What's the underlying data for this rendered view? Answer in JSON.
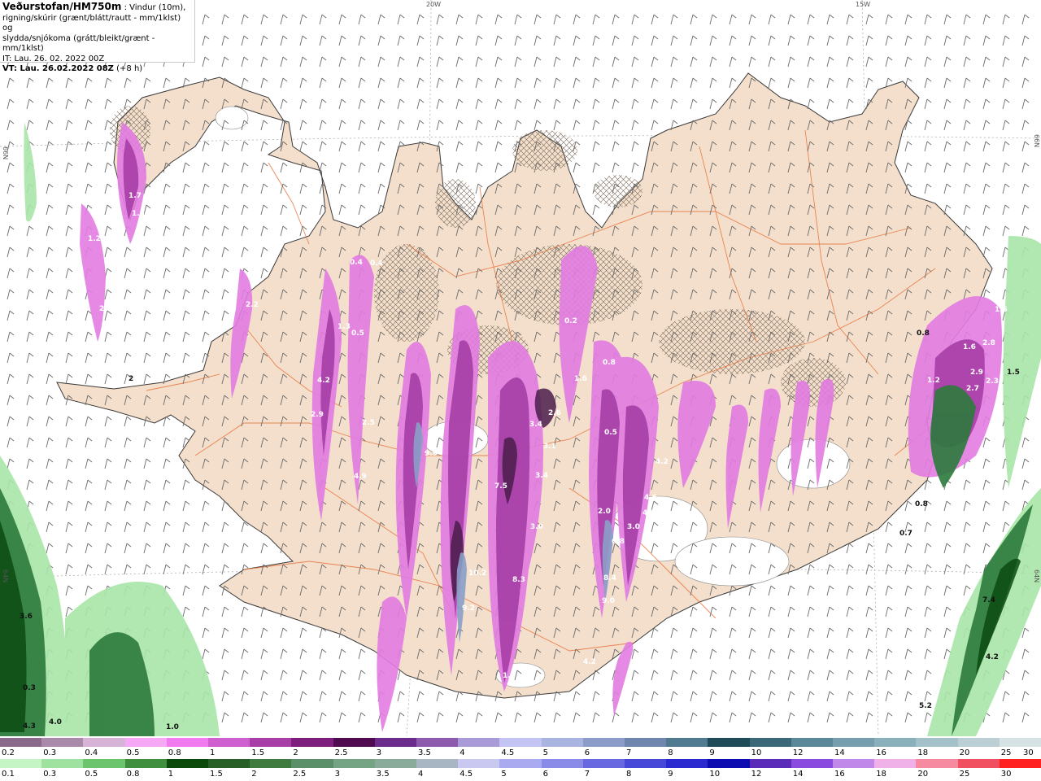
{
  "header": {
    "title": "Veðurstofan/HM750m",
    "desc_line1": ": Vindur (10m),",
    "desc_line2": "rigning/skúrir (grænt/blátt/rautt - mm/1klst) og",
    "desc_line3": "slydda/snjókoma (grátt/bleikt/grænt - mm/1klst)",
    "it": "IT: Lau. 26. 02. 2022 00Z",
    "vt_label": "VT: Lau. 26.02.2022 08Z",
    "vt_offset": "(+8 h)"
  },
  "grid_labels": {
    "lon": [
      "20W",
      "15W"
    ],
    "lat": [
      "66N",
      "64N"
    ]
  },
  "colors": {
    "land": "#f3dfcc",
    "coast": "#3a3a3a",
    "roads": "#e8743c",
    "ice": "#ffffff",
    "snow_light": "#e27ce2",
    "snow_mid": "#a63ea6",
    "snow_dark": "#4a1d4a",
    "rain_light": "#a8e6a8",
    "rain_mid": "#2c7a3c",
    "rain_dark": "#0b4a12"
  },
  "legend": {
    "snow": {
      "labels": [
        "0.2",
        "0.3",
        "0.4",
        "0.5",
        "0.8",
        "1",
        "1.5",
        "2",
        "2.5",
        "3",
        "3.5",
        "4",
        "4.5",
        "5",
        "6",
        "7",
        "8",
        "9",
        "10",
        "12",
        "14",
        "16",
        "18",
        "20",
        "25",
        "30"
      ],
      "colors": [
        "#8a6a8a",
        "#a98aa9",
        "#d7b3d7",
        "#f6a7f6",
        "#f07bf0",
        "#d060d0",
        "#a73fa7",
        "#7e1f7e",
        "#500a50",
        "#6c2c8c",
        "#8e5aae",
        "#a99ad8",
        "#c3c3f4",
        "#a9b4e0",
        "#8c9cc8",
        "#6f86ae",
        "#4f7a90",
        "#1f4a58",
        "#3a6878",
        "#5a8898",
        "#779eae",
        "#8ab0bc",
        "#a4c0c8",
        "#bccfd4",
        "#d7e2e4"
      ]
    },
    "rain": {
      "labels": [
        "0.1",
        "0.3",
        "0.5",
        "0.8",
        "1",
        "1.5",
        "2",
        "2.5",
        "3",
        "3.5",
        "4",
        "4.5",
        "5",
        "6",
        "7",
        "8",
        "9",
        "10",
        "12",
        "14",
        "16",
        "18",
        "20",
        "25",
        "30"
      ],
      "colors": [
        "#c5f5c5",
        "#9fe29f",
        "#6cc46c",
        "#3f8f3f",
        "#0b4a0b",
        "#275f27",
        "#3f7b3f",
        "#5a8f6a",
        "#74a484",
        "#8aaa9a",
        "#a8b6c4",
        "#c8c8f0",
        "#aaaaf0",
        "#8a8ae8",
        "#6868e0",
        "#4848d8",
        "#2a2ad0",
        "#0c0cb0",
        "#5a2ab8",
        "#8a4ae0",
        "#c088e8",
        "#f0b0e8",
        "#f58aa0",
        "#f05060",
        "#ff2020"
      ]
    }
  },
  "map_values": [
    {
      "v": "1.7"
    },
    {
      "v": "1.5"
    },
    {
      "v": "2.8"
    },
    {
      "v": "1.2"
    },
    {
      "v": "2.2"
    },
    {
      "v": "0.4"
    },
    {
      "v": "0.4"
    },
    {
      "v": "1.3"
    },
    {
      "v": "0.5"
    },
    {
      "v": "4.2"
    },
    {
      "v": "2.9"
    },
    {
      "v": "2.5"
    },
    {
      "v": "4.9"
    },
    {
      "v": "9.9"
    },
    {
      "v": "7.5"
    },
    {
      "v": "3.4"
    },
    {
      "v": "2.6"
    },
    {
      "v": "3.4"
    },
    {
      "v": "3.1"
    },
    {
      "v": "3.0"
    },
    {
      "v": "0.2"
    },
    {
      "v": "1.6"
    },
    {
      "v": "0.8"
    },
    {
      "v": "0.5"
    },
    {
      "v": "4.2"
    },
    {
      "v": "4.6"
    },
    {
      "v": "4.7"
    },
    {
      "v": "3.0"
    },
    {
      "v": "6.8"
    },
    {
      "v": "8.4"
    },
    {
      "v": "9.0"
    },
    {
      "v": "2.0"
    },
    {
      "v": "8.3"
    },
    {
      "v": "10.2"
    },
    {
      "v": "9.2"
    },
    {
      "v": "1.7"
    },
    {
      "v": "4.2"
    },
    {
      "v": "1.2"
    },
    {
      "v": "2.9"
    },
    {
      "v": "2.7"
    },
    {
      "v": "2.3"
    },
    {
      "v": "1.6"
    },
    {
      "v": "2.8"
    },
    {
      "v": "1.5"
    },
    {
      "v": "0.8"
    },
    {
      "v": "0.8"
    },
    {
      "v": "0.7"
    },
    {
      "v": "3.6"
    },
    {
      "v": "0.3"
    },
    {
      "v": "4.3"
    },
    {
      "v": "4.0"
    },
    {
      "v": "1.0"
    },
    {
      "v": "7.4"
    },
    {
      "v": "4.2"
    },
    {
      "v": "5.2"
    },
    {
      "v": "2"
    },
    {
      "v": "1.5"
    }
  ]
}
